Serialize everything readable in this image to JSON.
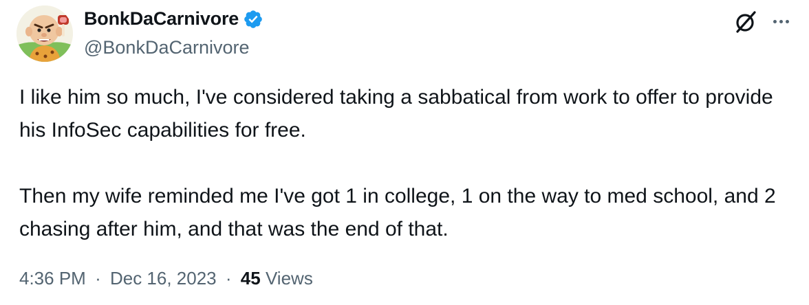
{
  "author": {
    "display_name": "BonkDaCarnivore",
    "handle": "@BonkDaCarnivore",
    "verified": true,
    "avatar_icon": "cartoon-caveman-avatar",
    "verified_icon": "verified-badge-icon"
  },
  "actions": {
    "grok_icon": "grok-icon",
    "more_icon": "more-options-icon"
  },
  "tweet": {
    "paragraphs": [
      "I like him so much, I've considered taking a sabbatical from work to offer to provide his InfoSec capabilities for free.",
      "Then my wife reminded me I've got 1 in college, 1 on the way to med school, and 2 chasing after him, and that was the end of that."
    ],
    "time": "4:36 PM",
    "separator": "·",
    "date": "Dec 16, 2023",
    "views_count": "45",
    "views_label": "Views"
  },
  "colors": {
    "text_primary": "#0f1419",
    "text_secondary": "#536471",
    "verified_blue": "#1d9bf0",
    "background": "#ffffff"
  }
}
